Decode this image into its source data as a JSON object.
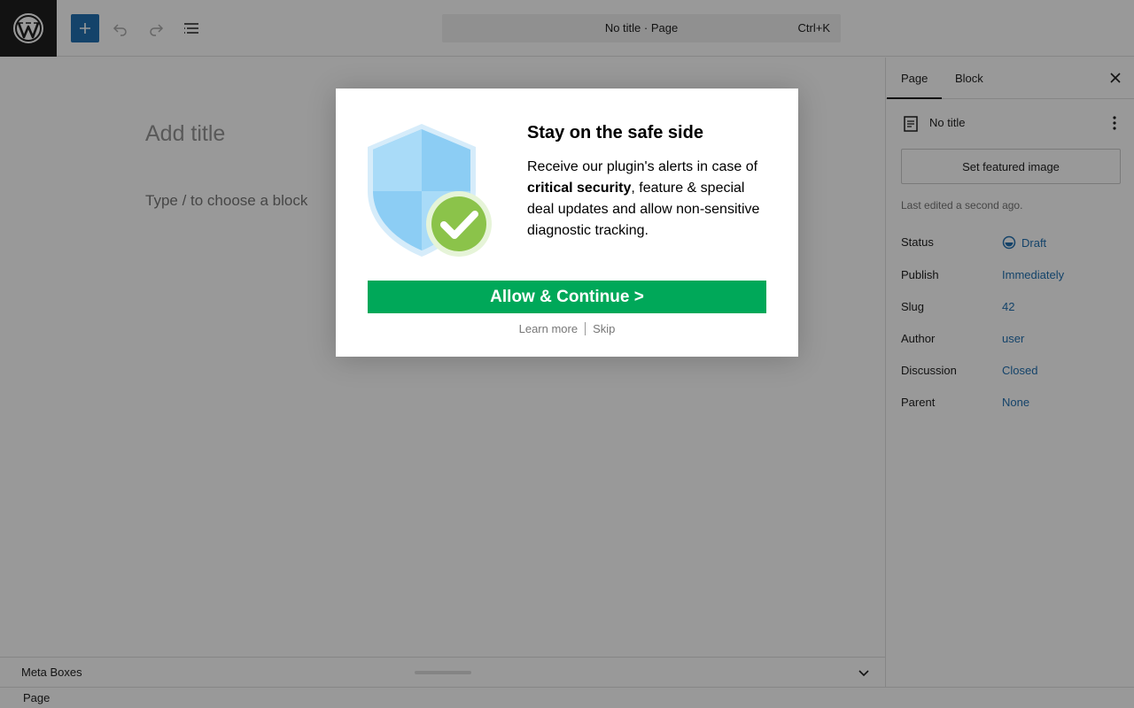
{
  "toolbar": {
    "logo_icon": "wordpress-logo",
    "add_icon": "plus-icon",
    "undo_icon": "undo-icon",
    "redo_icon": "redo-icon",
    "list_view_icon": "document-overview-icon",
    "command_bar": {
      "title": "No title · Page",
      "shortcut": "Ctrl+K"
    },
    "accent_color": "#2271b1"
  },
  "canvas": {
    "title_placeholder": "Add title",
    "block_placeholder": "Type / to choose a block"
  },
  "meta_boxes": {
    "label": "Meta Boxes"
  },
  "footer": {
    "breadcrumb": "Page"
  },
  "sidebar": {
    "tabs": [
      {
        "label": "Page",
        "active": true
      },
      {
        "label": "Block",
        "active": false
      }
    ],
    "doc_title": "No title",
    "featured_image_label": "Set featured image",
    "last_edited": "Last edited a second ago.",
    "rows": [
      {
        "label": "Status",
        "value": "Draft"
      },
      {
        "label": "Publish",
        "value": "Immediately"
      },
      {
        "label": "Slug",
        "value": "42"
      },
      {
        "label": "Author",
        "value": "user"
      },
      {
        "label": "Discussion",
        "value": "Closed"
      },
      {
        "label": "Parent",
        "value": "None"
      }
    ]
  },
  "modal": {
    "heading": "Stay on the safe side",
    "body_before": "Receive our plugin's alerts in case of ",
    "body_bold": "critical security",
    "body_after": ", feature & special deal updates and allow non-sensitive diagnostic tracking.",
    "allow_button": "Allow & Continue  >",
    "learn_more": "Learn more",
    "skip": "Skip",
    "button_color": "#00a859",
    "shield_icon": "shield-check-icon"
  }
}
